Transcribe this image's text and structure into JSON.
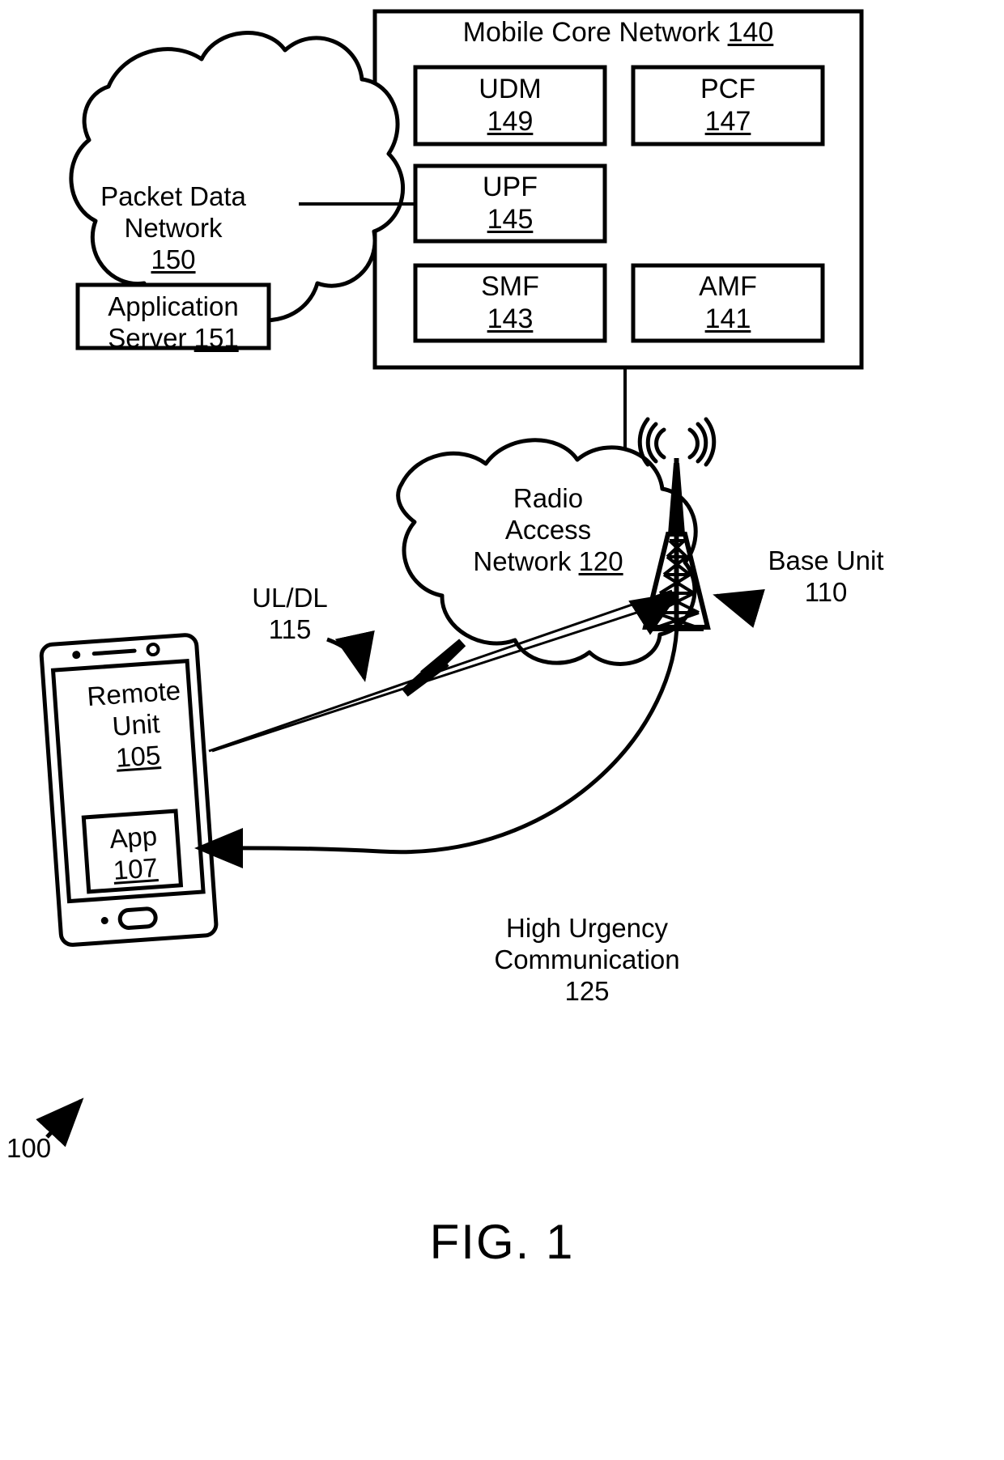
{
  "figure": {
    "caption": "FIG. 1",
    "system_ref": "100"
  },
  "mobile_core_network": {
    "title": "Mobile Core Network",
    "ref": "140",
    "functions": [
      {
        "name": "UDM",
        "ref": "149"
      },
      {
        "name": "PCF",
        "ref": "147"
      },
      {
        "name": "UPF",
        "ref": "145"
      },
      {
        "name": "SMF",
        "ref": "143"
      },
      {
        "name": "AMF",
        "ref": "141"
      }
    ]
  },
  "packet_data_network": {
    "line1": "Packet Data",
    "line2": "Network",
    "ref": "150",
    "application_server": {
      "line1": "Application",
      "line2": "Server",
      "ref": "151"
    }
  },
  "radio_access_network": {
    "line1": "Radio",
    "line2": "Access",
    "line3": "Network",
    "ref": "120"
  },
  "base_unit": {
    "label": "Base Unit",
    "ref": "110"
  },
  "remote_unit": {
    "line1": "Remote",
    "line2": "Unit",
    "ref": "105",
    "app": {
      "label": "App",
      "ref": "107"
    }
  },
  "links": {
    "uldl": {
      "label": "UL/DL",
      "ref": "115"
    },
    "high_urgency": {
      "line1": "High Urgency",
      "line2": "Communication",
      "ref": "125"
    }
  }
}
